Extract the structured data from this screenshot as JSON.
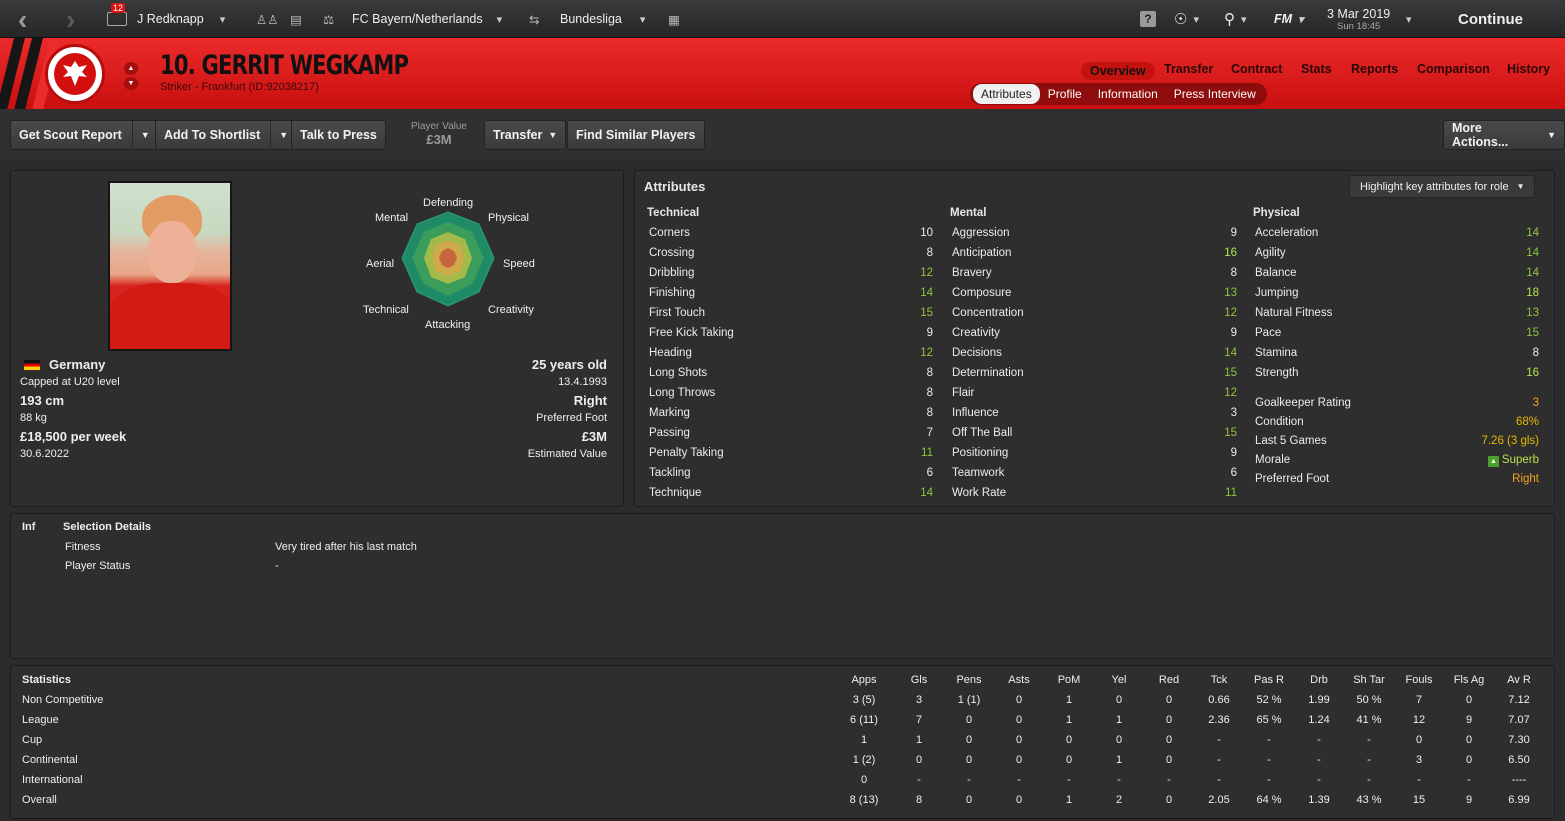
{
  "topbar": {
    "notifications": "12",
    "manager": "J Redknapp",
    "team": "FC Bayern/Netherlands",
    "league": "Bundesliga",
    "fm_label": "FM",
    "date": "3 Mar 2019",
    "time": "Sun 18:45",
    "continue_label": "Continue",
    "help_label": "?"
  },
  "player": {
    "name": "10. GERRIT WEGKAMP",
    "subtitle": "Striker - Frankfurt (ID:92038217)",
    "nation": "Germany",
    "caps": "Capped at U20 level",
    "height": "193 cm",
    "weight": "88 kg",
    "wage": "£18,500 per week",
    "contract_end": "30.6.2022",
    "age": "25 years old",
    "dob": "13.4.1993",
    "foot": "Right",
    "foot_label": "Preferred Foot",
    "value": "£3M",
    "value_label": "Estimated Value"
  },
  "tabs": {
    "main": [
      "Overview",
      "Transfer",
      "Contract",
      "Stats",
      "Reports",
      "Comparison",
      "History"
    ],
    "sub": [
      "Attributes",
      "Profile",
      "Information",
      "Press Interview"
    ]
  },
  "actions": {
    "scout": "Get Scout Report",
    "shortlist": "Add To Shortlist",
    "press": "Talk to Press",
    "pv_label": "Player Value",
    "pv_value": "£3M",
    "transfer": "Transfer",
    "similar": "Find Similar Players",
    "more": "More Actions..."
  },
  "radar": {
    "labels": [
      "Defending",
      "Physical",
      "Speed",
      "Creativity",
      "Attacking",
      "Technical",
      "Aerial",
      "Mental"
    ]
  },
  "attributes": {
    "title": "Attributes",
    "highlight": "Highlight key attributes for role",
    "technical_title": "Technical",
    "mental_title": "Mental",
    "physical_title": "Physical",
    "technical": [
      {
        "n": "Corners",
        "v": "10"
      },
      {
        "n": "Crossing",
        "v": "8"
      },
      {
        "n": "Dribbling",
        "v": "12"
      },
      {
        "n": "Finishing",
        "v": "14"
      },
      {
        "n": "First Touch",
        "v": "15"
      },
      {
        "n": "Free Kick Taking",
        "v": "9"
      },
      {
        "n": "Heading",
        "v": "12"
      },
      {
        "n": "Long Shots",
        "v": "8"
      },
      {
        "n": "Long Throws",
        "v": "8"
      },
      {
        "n": "Marking",
        "v": "8"
      },
      {
        "n": "Passing",
        "v": "7"
      },
      {
        "n": "Penalty Taking",
        "v": "11"
      },
      {
        "n": "Tackling",
        "v": "6"
      },
      {
        "n": "Technique",
        "v": "14"
      }
    ],
    "mental": [
      {
        "n": "Aggression",
        "v": "9"
      },
      {
        "n": "Anticipation",
        "v": "16"
      },
      {
        "n": "Bravery",
        "v": "8"
      },
      {
        "n": "Composure",
        "v": "13"
      },
      {
        "n": "Concentration",
        "v": "12"
      },
      {
        "n": "Creativity",
        "v": "9"
      },
      {
        "n": "Decisions",
        "v": "14"
      },
      {
        "n": "Determination",
        "v": "15"
      },
      {
        "n": "Flair",
        "v": "12"
      },
      {
        "n": "Influence",
        "v": "3"
      },
      {
        "n": "Off The Ball",
        "v": "15"
      },
      {
        "n": "Positioning",
        "v": "9"
      },
      {
        "n": "Teamwork",
        "v": "6"
      },
      {
        "n": "Work Rate",
        "v": "11"
      }
    ],
    "physical": [
      {
        "n": "Acceleration",
        "v": "14"
      },
      {
        "n": "Agility",
        "v": "14"
      },
      {
        "n": "Balance",
        "v": "14"
      },
      {
        "n": "Jumping",
        "v": "18"
      },
      {
        "n": "Natural Fitness",
        "v": "13"
      },
      {
        "n": "Pace",
        "v": "15"
      },
      {
        "n": "Stamina",
        "v": "8"
      },
      {
        "n": "Strength",
        "v": "16"
      }
    ],
    "extra": [
      {
        "n": "Goalkeeper Rating",
        "v": "3"
      },
      {
        "n": "Condition",
        "v": "68%"
      },
      {
        "n": "Last 5 Games",
        "v": "7.26 (3 gls)"
      },
      {
        "n": "Morale",
        "v": "Superb"
      },
      {
        "n": "Preferred Foot",
        "v": "Right"
      }
    ]
  },
  "selection": {
    "inf": "Inf",
    "title": "Selection Details",
    "rows": [
      {
        "label": "Fitness",
        "value": "Very tired after his last match"
      },
      {
        "label": "Player Status",
        "value": "-"
      }
    ]
  },
  "statistics": {
    "title": "Statistics",
    "headers": [
      "Apps",
      "Gls",
      "Pens",
      "Asts",
      "PoM",
      "Yel",
      "Red",
      "Tck",
      "Pas R",
      "Drb",
      "Sh Tar",
      "Fouls",
      "Fls Ag",
      "Av R"
    ],
    "rows": [
      {
        "name": "Non Competitive",
        "cells": [
          "3 (5)",
          "3",
          "1 (1)",
          "0",
          "1",
          "0",
          "0",
          "0.66",
          "52 %",
          "1.99",
          "50 %",
          "7",
          "0",
          "7.12"
        ]
      },
      {
        "name": "League",
        "cells": [
          "6 (11)",
          "7",
          "0",
          "0",
          "1",
          "1",
          "0",
          "2.36",
          "65 %",
          "1.24",
          "41 %",
          "12",
          "9",
          "7.07"
        ]
      },
      {
        "name": "Cup",
        "cells": [
          "1",
          "1",
          "0",
          "0",
          "0",
          "0",
          "0",
          "-",
          "-",
          "-",
          "-",
          "0",
          "0",
          "7.30"
        ]
      },
      {
        "name": "Continental",
        "cells": [
          "1 (2)",
          "0",
          "0",
          "0",
          "0",
          "1",
          "0",
          "-",
          "-",
          "-",
          "-",
          "3",
          "0",
          "6.50"
        ]
      },
      {
        "name": "International",
        "cells": [
          "0",
          "-",
          "-",
          "-",
          "-",
          "-",
          "-",
          "-",
          "-",
          "-",
          "-",
          "-",
          "-",
          "----"
        ]
      },
      {
        "name": "Overall",
        "cells": [
          "8 (13)",
          "8",
          "0",
          "0",
          "1",
          "2",
          "0",
          "2.05",
          "64 %",
          "1.39",
          "43 %",
          "15",
          "9",
          "6.99"
        ]
      }
    ]
  },
  "colors": {
    "header_red": "#d81414",
    "attr_green": "#8cc63f",
    "attr_bright_green": "#b5e34d",
    "attr_gold": "#e6b800",
    "attr_orange": "#f2a324"
  }
}
